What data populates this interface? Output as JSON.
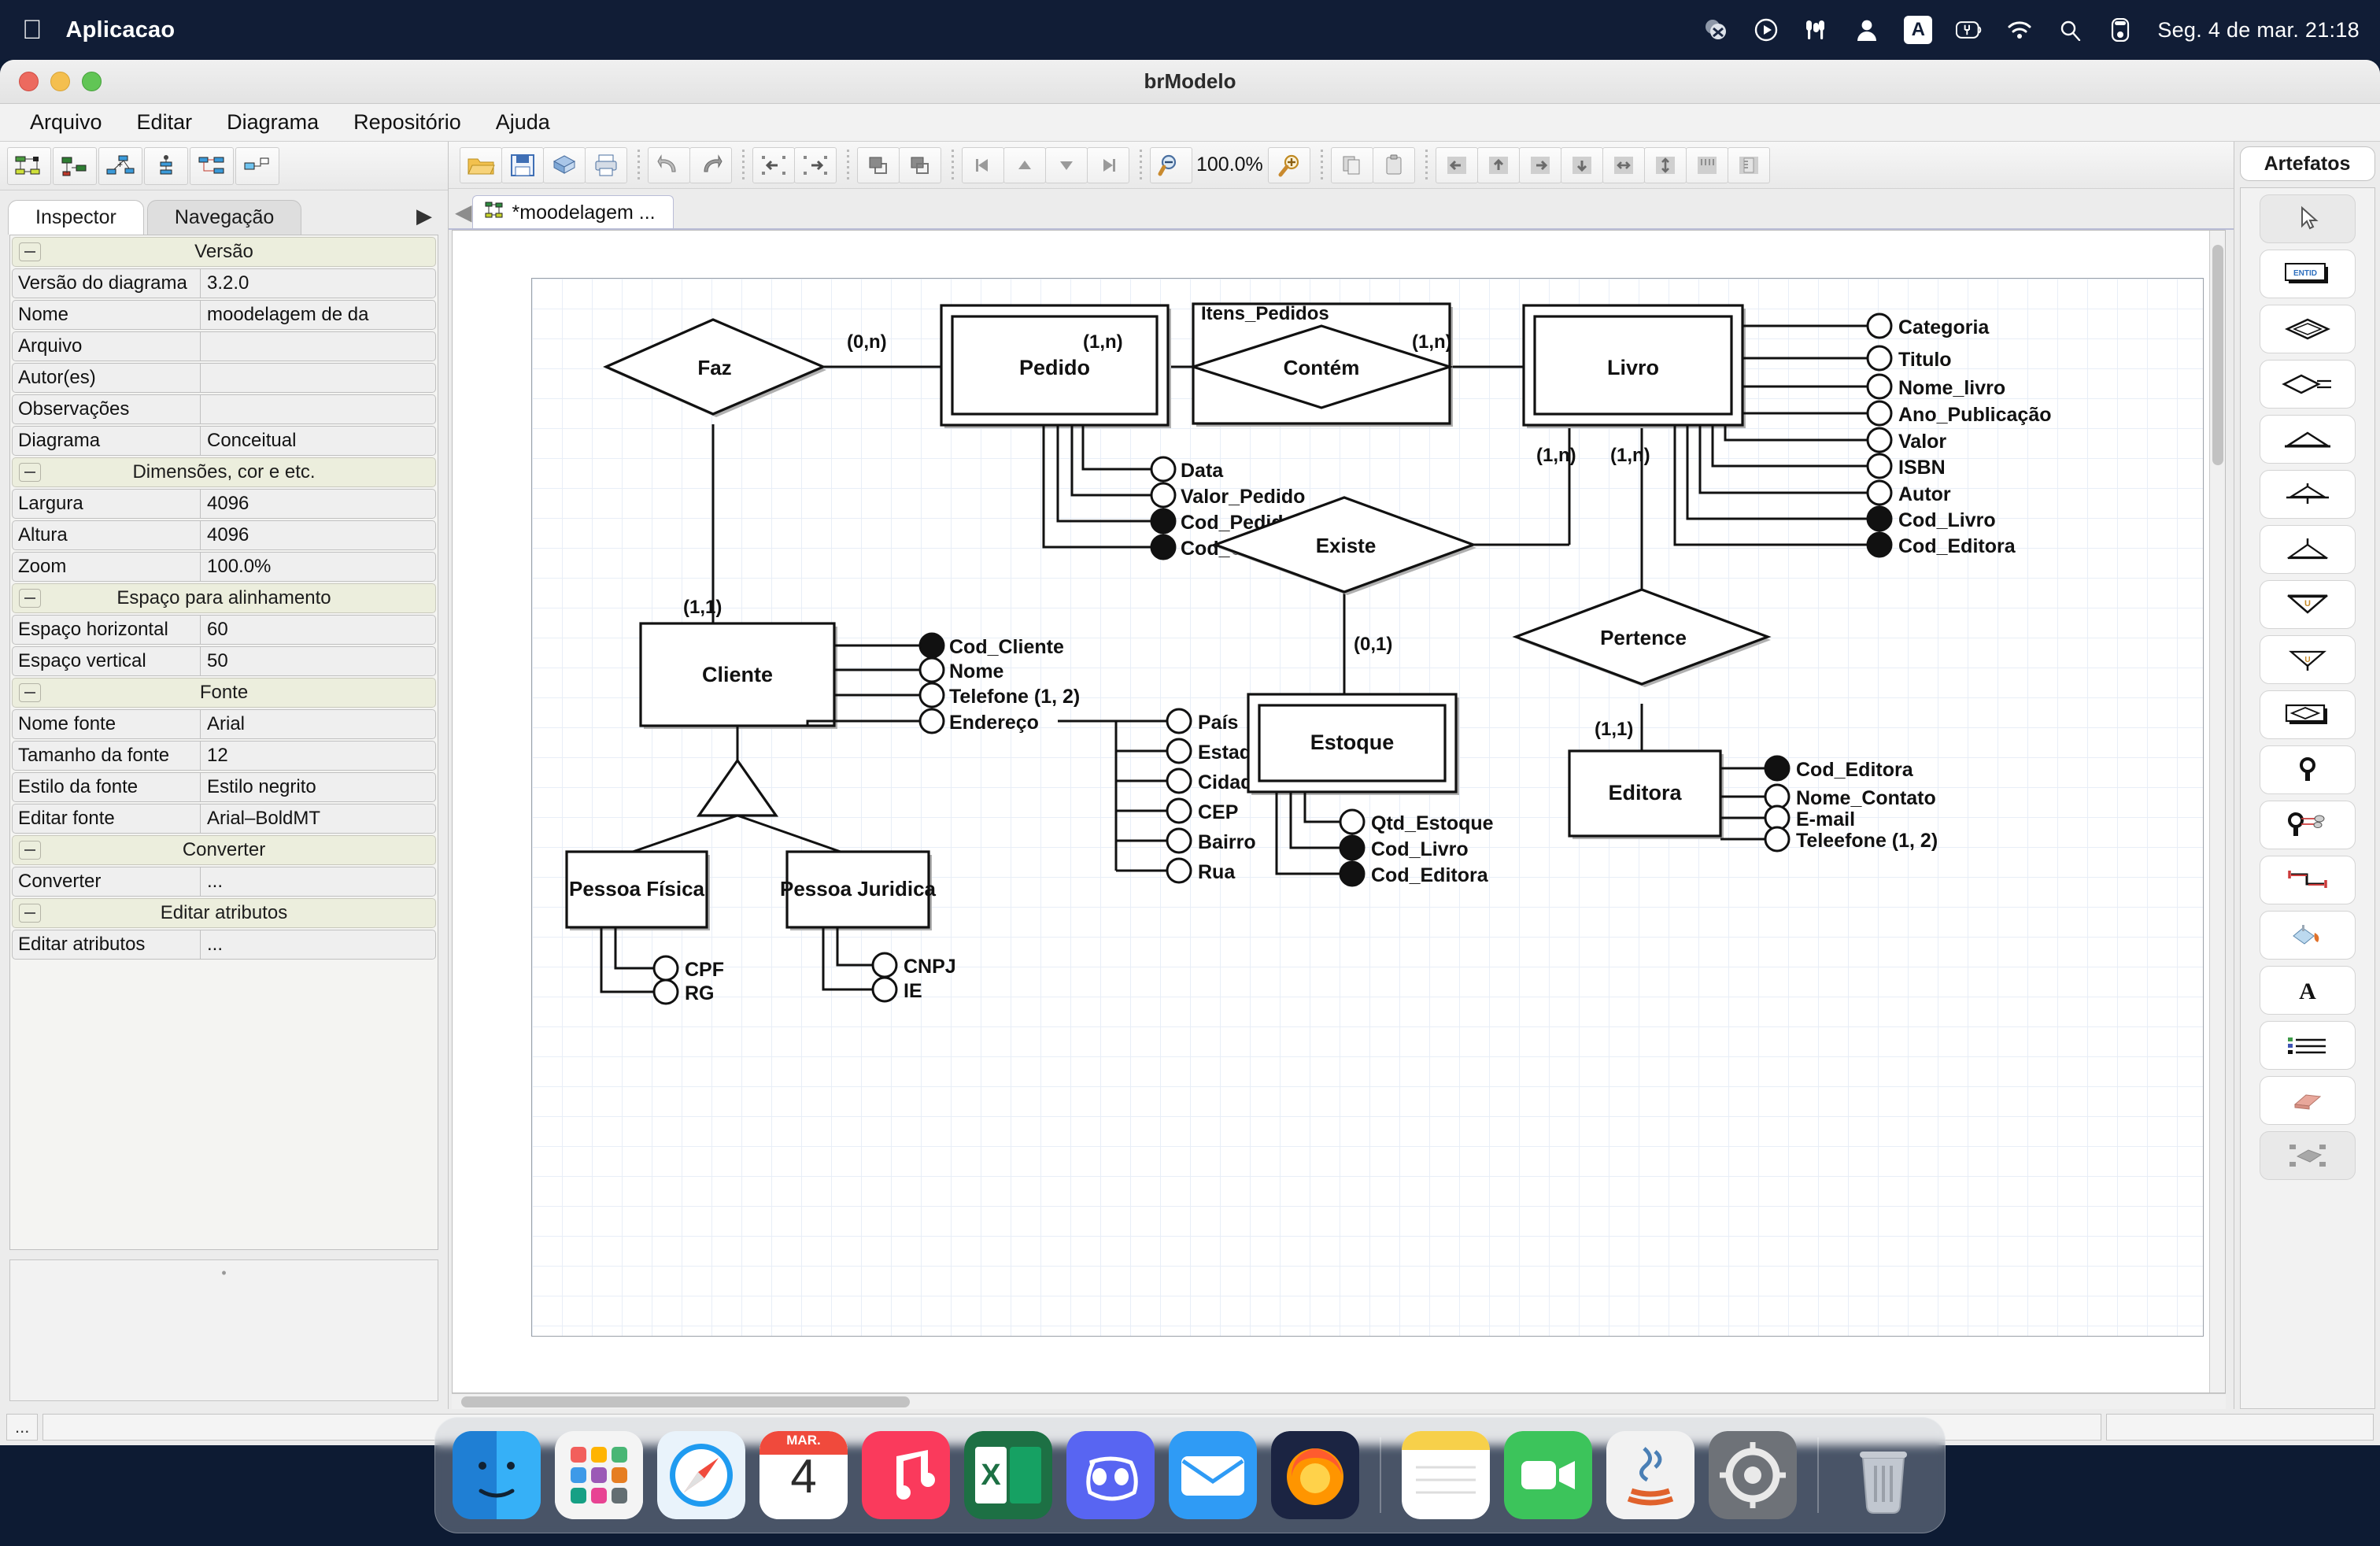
{
  "menubar": {
    "app_name": "Aplicacao",
    "clock": "Seg. 4 de mar.  21:18",
    "input_badge": "A",
    "icons": [
      "dropbox-icon",
      "play-circle-icon",
      "airpods-icon",
      "user-icon",
      "input-source-icon",
      "battery-icon",
      "wifi-icon",
      "search-icon",
      "control-center-icon"
    ]
  },
  "window": {
    "title": "brModelo",
    "menu": [
      "Arquivo",
      "Editar",
      "Diagrama",
      "Repositório",
      "Ajuda"
    ]
  },
  "left_panel": {
    "tabs": [
      {
        "label": "Inspector",
        "active": true
      },
      {
        "label": "Navegação",
        "active": false
      }
    ],
    "tab_overflow": "▶",
    "groups": [
      {
        "title": "Versão",
        "rows": [
          {
            "key": "Versão do diagrama",
            "value": "3.2.0"
          },
          {
            "key": "Nome",
            "value": "moodelagem de da"
          },
          {
            "key": "Arquivo",
            "value": ""
          },
          {
            "key": "Autor(es)",
            "value": ""
          },
          {
            "key": "Observações",
            "value": ""
          },
          {
            "key": "Diagrama",
            "value": "Conceitual"
          }
        ]
      },
      {
        "title": "Dimensões, cor e etc.",
        "rows": [
          {
            "key": "Largura",
            "value": "4096"
          },
          {
            "key": "Altura",
            "value": "4096"
          },
          {
            "key": "Zoom",
            "value": "100.0%"
          }
        ]
      },
      {
        "title": "Espaço para alinhamento",
        "rows": [
          {
            "key": "Espaço horizontal",
            "value": "60"
          },
          {
            "key": "Espaço vertical",
            "value": "50"
          }
        ]
      },
      {
        "title": "Fonte",
        "rows": [
          {
            "key": "Nome fonte",
            "value": "Arial"
          },
          {
            "key": "Tamanho da fonte",
            "value": "12"
          },
          {
            "key": "Estilo da fonte",
            "value": "Estilo negrito"
          },
          {
            "key": "Editar fonte",
            "value": "Arial–BoldMT"
          }
        ]
      },
      {
        "title": "Converter",
        "rows": [
          {
            "key": "Converter",
            "value": "..."
          }
        ]
      },
      {
        "title": "Editar atributos",
        "rows": [
          {
            "key": "Editar atributos",
            "value": "..."
          }
        ]
      }
    ]
  },
  "canvas_toolbar": {
    "zoom_value": "100.0%",
    "buttons": [
      "open-icon",
      "save-icon",
      "package-icon",
      "print-icon",
      "undo-icon",
      "redo-icon",
      "nav-back-icon",
      "nav-forward-icon",
      "bring-front-icon",
      "send-back-icon",
      "first-icon",
      "up-icon",
      "down-icon",
      "last-icon",
      "zoom-out-icon",
      "zoom-in-icon",
      "copy-icon",
      "paste-icon",
      "align-left-icon",
      "align-top-icon",
      "align-right-icon",
      "align-bottom-icon",
      "center-h-icon",
      "center-v-icon",
      "grid-icon",
      "ruler-icon"
    ]
  },
  "document_tab": {
    "label": "*moodelagem ...",
    "icon": "diagram-icon"
  },
  "right_panel": {
    "title": "Artefatos",
    "tools": [
      {
        "name": "pointer-icon",
        "selected": true
      },
      {
        "name": "entity-icon",
        "selected": false
      },
      {
        "name": "relationship-icon",
        "selected": false
      },
      {
        "name": "relationship-attr-icon",
        "selected": false
      },
      {
        "name": "generalization-icon",
        "selected": false
      },
      {
        "name": "specialization-icon",
        "selected": false
      },
      {
        "name": "inheritance-icon",
        "selected": false
      },
      {
        "name": "union-down-icon",
        "selected": false
      },
      {
        "name": "union-up-icon",
        "selected": false
      },
      {
        "name": "associative-entity-icon",
        "selected": false
      },
      {
        "name": "attribute-icon",
        "selected": false
      },
      {
        "name": "composite-attribute-icon",
        "selected": false
      },
      {
        "name": "connector-icon",
        "selected": false
      },
      {
        "name": "fill-color-icon",
        "selected": false
      },
      {
        "name": "text-icon",
        "selected": false
      },
      {
        "name": "list-icon",
        "selected": false
      },
      {
        "name": "eraser-icon",
        "selected": false
      },
      {
        "name": "select-area-icon",
        "selected": true
      }
    ]
  },
  "diagram": {
    "entities": [
      {
        "id": "pedido",
        "label": "Pedido",
        "weak": true
      },
      {
        "id": "livro",
        "label": "Livro",
        "weak": true
      },
      {
        "id": "cliente",
        "label": "Cliente",
        "weak": false
      },
      {
        "id": "pessoa_fisica",
        "label": "Pessoa Física",
        "weak": false
      },
      {
        "id": "pessoa_juridica",
        "label": "Pessoa Juridica",
        "weak": false
      },
      {
        "id": "estoque",
        "label": "Estoque",
        "weak": true
      },
      {
        "id": "editora",
        "label": "Editora",
        "weak": false
      }
    ],
    "relationships": [
      {
        "id": "faz",
        "label": "Faz"
      },
      {
        "id": "contem",
        "label": "Contém",
        "boxed_label": "Itens_Pedidos"
      },
      {
        "id": "existe",
        "label": "Existe"
      },
      {
        "id": "pertence",
        "label": "Pertence"
      }
    ],
    "attributes": {
      "pedido": [
        {
          "label": "Data",
          "key": false
        },
        {
          "label": "Valor_Pedido",
          "key": false
        },
        {
          "label": "Cod_Pedido",
          "key": true
        },
        {
          "label": "Cod_Cliente",
          "key": true
        }
      ],
      "livro": [
        {
          "label": "Categoria",
          "key": false
        },
        {
          "label": "Titulo",
          "key": false
        },
        {
          "label": "Nome_livro",
          "key": false
        },
        {
          "label": "Ano_Publicação",
          "key": false
        },
        {
          "label": "Valor",
          "key": false
        },
        {
          "label": "ISBN",
          "key": false
        },
        {
          "label": "Autor",
          "key": false
        },
        {
          "label": "Cod_Livro",
          "key": true
        },
        {
          "label": "Cod_Editora",
          "key": true
        }
      ],
      "cliente": [
        {
          "label": "Cod_Cliente",
          "key": true
        },
        {
          "label": "Nome",
          "key": false
        },
        {
          "label": "Telefone (1, 2)",
          "key": false
        },
        {
          "label": "Endereço",
          "key": false
        }
      ],
      "endereco_parts": [
        {
          "label": "País",
          "key": false
        },
        {
          "label": "Estado",
          "key": false
        },
        {
          "label": "Cidade",
          "key": false
        },
        {
          "label": "CEP",
          "key": false
        },
        {
          "label": "Bairro",
          "key": false
        },
        {
          "label": "Rua",
          "key": false
        }
      ],
      "pessoa_fisica": [
        {
          "label": "CPF",
          "key": false
        },
        {
          "label": "RG",
          "key": false
        }
      ],
      "pessoa_juridica": [
        {
          "label": "CNPJ",
          "key": false
        },
        {
          "label": "IE",
          "key": false
        }
      ],
      "estoque": [
        {
          "label": "Qtd_Estoque",
          "key": false
        },
        {
          "label": "Cod_Livro",
          "key": true
        },
        {
          "label": "Cod_Editora",
          "key": true
        }
      ],
      "editora": [
        {
          "label": "Cod_Editora",
          "key": true
        },
        {
          "label": "Nome_Contato",
          "key": false
        },
        {
          "label": "E-mail",
          "key": false
        },
        {
          "label": "Teleefone (1, 2)",
          "key": false
        }
      ]
    },
    "cardinalities": [
      {
        "id": "faz-pedido",
        "text": "(0,n)"
      },
      {
        "id": "pedido-contem",
        "text": "(1,n)"
      },
      {
        "id": "contem-livro",
        "text": "(1,n)"
      },
      {
        "id": "faz-cliente",
        "text": "(1,1)"
      },
      {
        "id": "livro-existe",
        "text": "(1,n)"
      },
      {
        "id": "livro-pertence",
        "text": "(1,n)"
      },
      {
        "id": "existe-estoque",
        "text": "(0,1)"
      },
      {
        "id": "pertence-editora",
        "text": "(1,1)"
      }
    ]
  },
  "dock": {
    "calendar_month": "MAR.",
    "calendar_day": "4",
    "items": [
      "finder",
      "launchpad",
      "safari",
      "calendar",
      "music",
      "excel",
      "discord",
      "mail",
      "firefox",
      "notes",
      "facetime",
      "java",
      "settings",
      "trash"
    ]
  }
}
